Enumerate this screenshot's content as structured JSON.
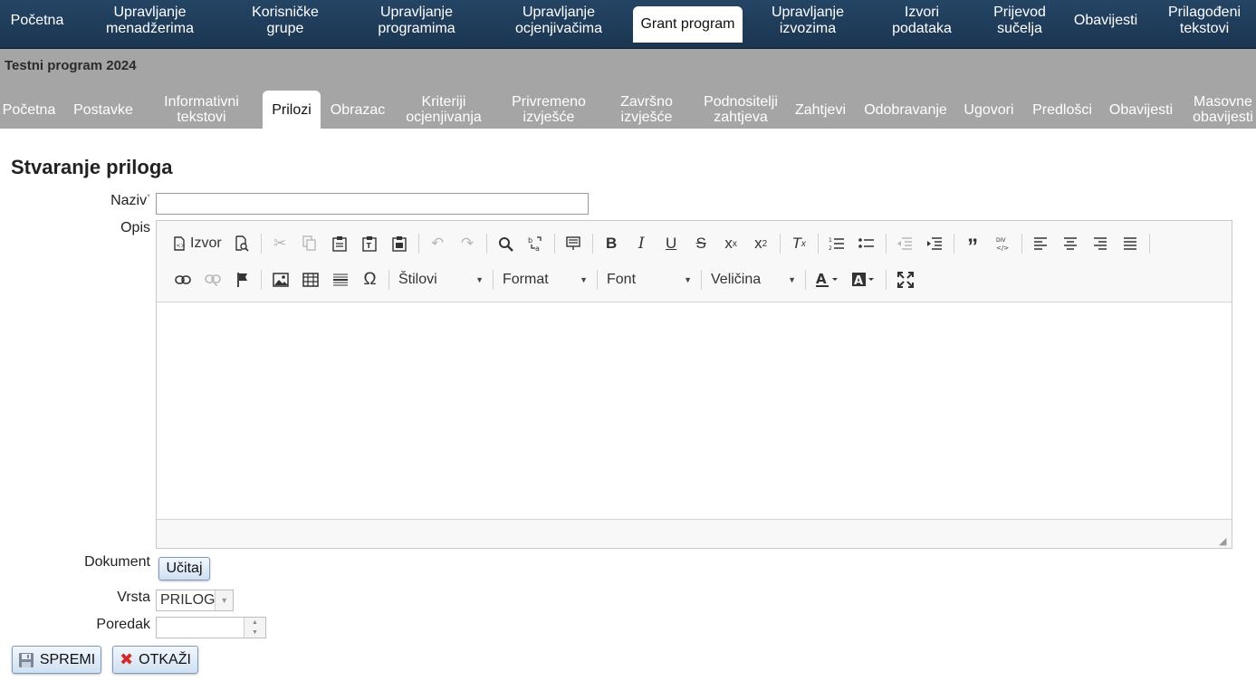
{
  "topnav": [
    {
      "label": "Početna"
    },
    {
      "label": "Upravljanje\nmenadžerima"
    },
    {
      "label": "Korisničke\ngrupe"
    },
    {
      "label": "Upravljanje\nprogramima"
    },
    {
      "label": "Upravljanje\nocjenjivačima"
    },
    {
      "label": "Grant program"
    },
    {
      "label": "Upravljanje\nizvozima"
    },
    {
      "label": "Izvori\npodataka"
    },
    {
      "label": "Prijevod\nsučelja"
    },
    {
      "label": "Obavijesti"
    },
    {
      "label": "Prilagođeni\ntekstovi"
    }
  ],
  "program_title": "Testni program 2024",
  "subnav": [
    {
      "label": "Početna"
    },
    {
      "label": "Postavke"
    },
    {
      "label": "Informativni\ntekstovi"
    },
    {
      "label": "Prilozi"
    },
    {
      "label": "Obrazac"
    },
    {
      "label": "Kriteriji\nocjenjivanja"
    },
    {
      "label": "Privremeno\nizvješće"
    },
    {
      "label": "Završno\nizvješće"
    },
    {
      "label": "Podnositelji\nzahtjeva"
    },
    {
      "label": "Zahtjevi"
    },
    {
      "label": "Odobravanje"
    },
    {
      "label": "Ugovori"
    },
    {
      "label": "Predlošci"
    },
    {
      "label": "Obavijesti"
    },
    {
      "label": "Masovne\nobavijesti"
    }
  ],
  "page_title": "Stvaranje priloga",
  "form": {
    "naziv_label": "Naziv",
    "naziv_required": "*",
    "naziv_value": "",
    "opis_label": "Opis",
    "dokument_label": "Dokument",
    "upload_label": "Učitaj",
    "vrsta_label": "Vrsta",
    "vrsta_value": "PRILOG",
    "poredak_label": "Poredak",
    "poredak_value": ""
  },
  "editor": {
    "source_label": "Izvor",
    "styles_label": "Štilovi",
    "format_label": "Format",
    "font_label": "Font",
    "size_label": "Veličina"
  },
  "actions": {
    "save_label": "SPREMI",
    "cancel_label": "OTKAŽI"
  }
}
